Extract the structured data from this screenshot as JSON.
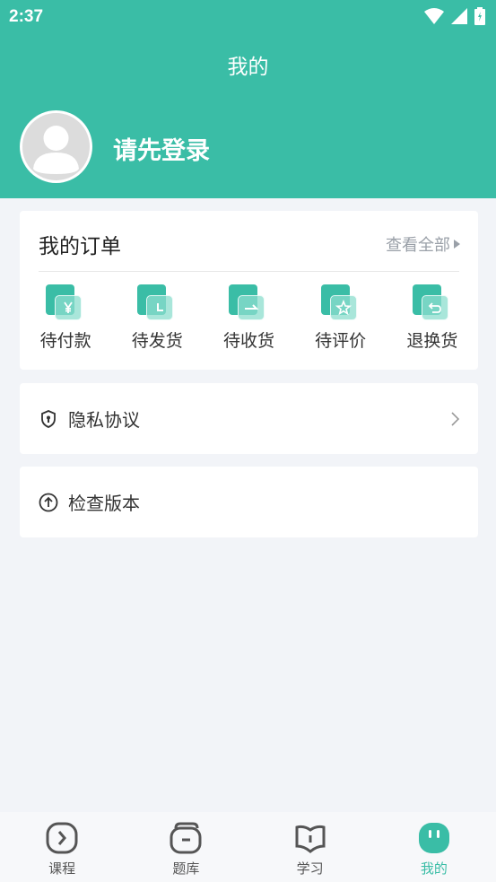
{
  "status_bar": {
    "time": "2:37"
  },
  "page": {
    "title": "我的"
  },
  "profile": {
    "login_prompt": "请先登录"
  },
  "orders": {
    "title": "我的订单",
    "view_all": "查看全部",
    "items": [
      {
        "label": "待付款",
        "icon": "yen-icon"
      },
      {
        "label": "待发货",
        "icon": "clock-icon"
      },
      {
        "label": "待收货",
        "icon": "arrow-right-icon"
      },
      {
        "label": "待评价",
        "icon": "star-icon"
      },
      {
        "label": "退换货",
        "icon": "return-icon"
      }
    ]
  },
  "menu": {
    "privacy": {
      "label": "隐私协议",
      "icon": "shield-icon"
    },
    "version": {
      "label": "检查版本",
      "icon": "upload-circle-icon"
    }
  },
  "tabs": [
    {
      "label": "课程",
      "icon": "play-circle-icon",
      "active": false
    },
    {
      "label": "题库",
      "icon": "wallet-icon",
      "active": false
    },
    {
      "label": "学习",
      "icon": "book-icon",
      "active": false
    },
    {
      "label": "我的",
      "icon": "face-icon",
      "active": true
    }
  ],
  "colors": {
    "accent": "#3abda6",
    "background": "#f2f4f8"
  }
}
